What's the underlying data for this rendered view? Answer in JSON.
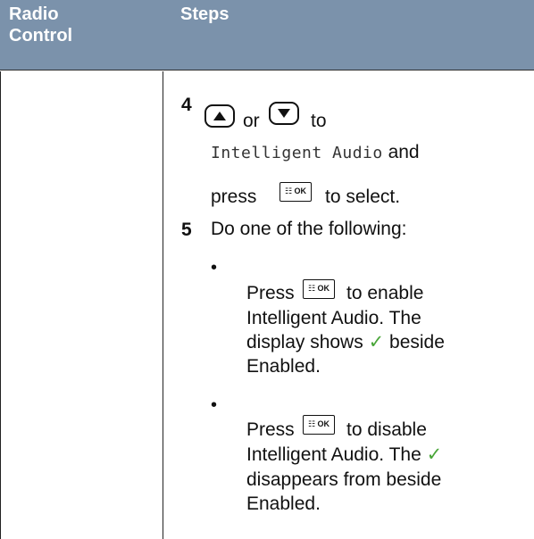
{
  "header": {
    "col1_line1": "Radio",
    "col1_line2": "Control",
    "col2": "Steps"
  },
  "step4": {
    "number": "4",
    "or": "or",
    "to": "to",
    "menu_item": "Intelligent Audio",
    "and": "and",
    "press": "press",
    "to_select": "to select."
  },
  "step5": {
    "number": "5",
    "text": "Do one of the following:",
    "bullets": [
      {
        "bullet": "•",
        "press": "Press",
        "l1": "to enable",
        "l2": "Intelligent Audio. The",
        "l3a": "display shows",
        "check": "✓",
        "l3b": "beside",
        "l4": "Enabled."
      },
      {
        "bullet": "•",
        "press": "Press",
        "l1": "to disable",
        "l2a": "Intelligent Audio. The",
        "check": "✓",
        "l3": "disappears from beside",
        "l4": "Enabled."
      }
    ]
  },
  "ok_key_label": "☷ OK",
  "icons": {
    "up": "up-arrow-key-icon",
    "down": "down-arrow-key-icon",
    "ok": "menu-ok-key-icon",
    "check": "checkmark-icon"
  },
  "colors": {
    "header_bg": "#7b92ab",
    "check": "#4aa63a"
  }
}
